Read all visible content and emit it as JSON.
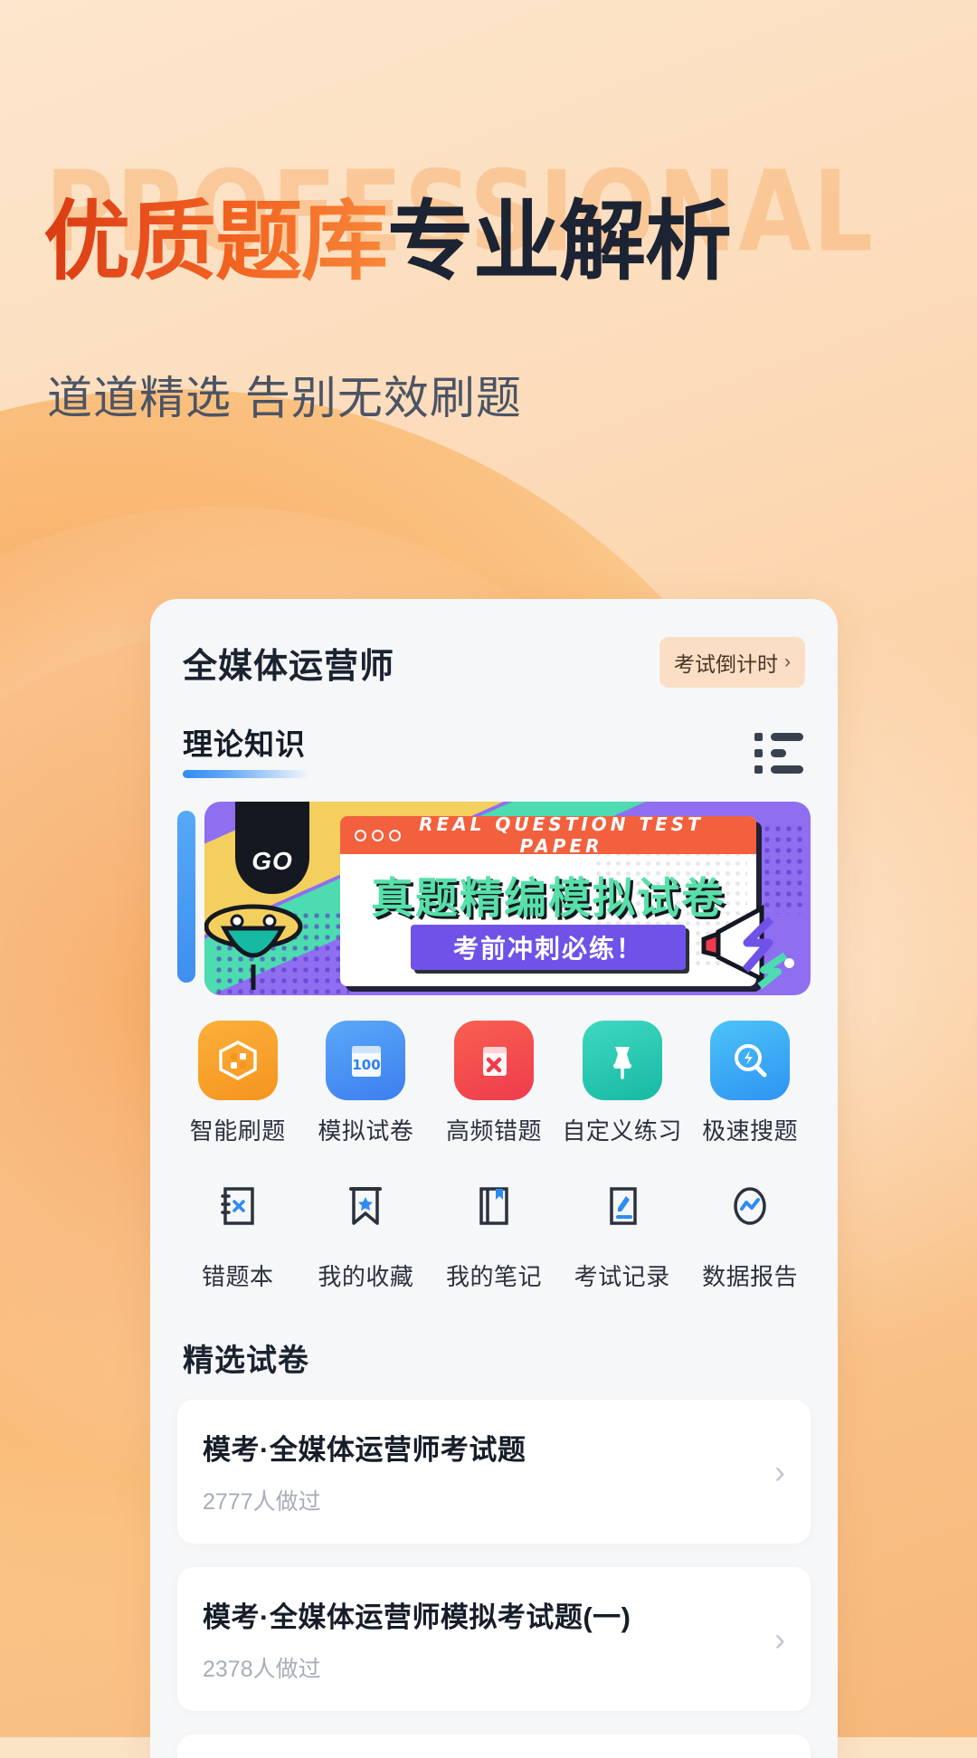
{
  "hero": {
    "ghost_text": "PROFESSIONAL",
    "title_part1": "优质题库",
    "title_part2": "专业解析",
    "subtitle": "道道精选 告别无效刷题",
    "accent_orange": "#f26522",
    "accent_dark": "#1c2333",
    "background_start": "#fde6cd",
    "background_end": "#f7b87a"
  },
  "card": {
    "title": "全媒体运营师",
    "countdown_label": "考试倒计时",
    "countdown_chevron": "›",
    "list_icon_name": "list-view-icon",
    "tabs": [
      {
        "label": "理论知识",
        "active": true
      }
    ]
  },
  "banner": {
    "go_badge": "GO",
    "header_text": "REAL QUESTION TEST PAPER",
    "title": "真题精编模拟试卷",
    "subtitle": "考前冲刺必练！",
    "colors": {
      "purple": "#8f6ef0",
      "yellow": "#f3cf5e",
      "mint": "#4ddbb0",
      "orange_bar": "#f2603e",
      "title_green": "#57e0a8",
      "sub_purple": "#6f52e8"
    }
  },
  "quick_actions": {
    "row1": [
      {
        "label": "智能刷题",
        "icon": "hexagon-puzzle-icon"
      },
      {
        "label": "模拟试卷",
        "icon": "paper-100-icon"
      },
      {
        "label": "高频错题",
        "icon": "book-x-icon"
      },
      {
        "label": "自定义练习",
        "icon": "pushpin-icon"
      },
      {
        "label": "极速搜题",
        "icon": "search-lightning-icon"
      }
    ],
    "row2": [
      {
        "label": "错题本",
        "icon": "notebook-x-icon"
      },
      {
        "label": "我的收藏",
        "icon": "bookmark-star-icon"
      },
      {
        "label": "我的笔记",
        "icon": "book-mark-icon"
      },
      {
        "label": "考试记录",
        "icon": "pencil-record-icon"
      },
      {
        "label": "数据报告",
        "icon": "chart-oval-icon"
      }
    ]
  },
  "papers": {
    "section_title": "精选试卷",
    "items": [
      {
        "name": "模考·全媒体运营师考试题",
        "meta": "2777人做过",
        "chevron": "›"
      },
      {
        "name": "模考·全媒体运营师模拟考试题(一)",
        "meta": "2378人做过",
        "chevron": "›"
      }
    ]
  }
}
